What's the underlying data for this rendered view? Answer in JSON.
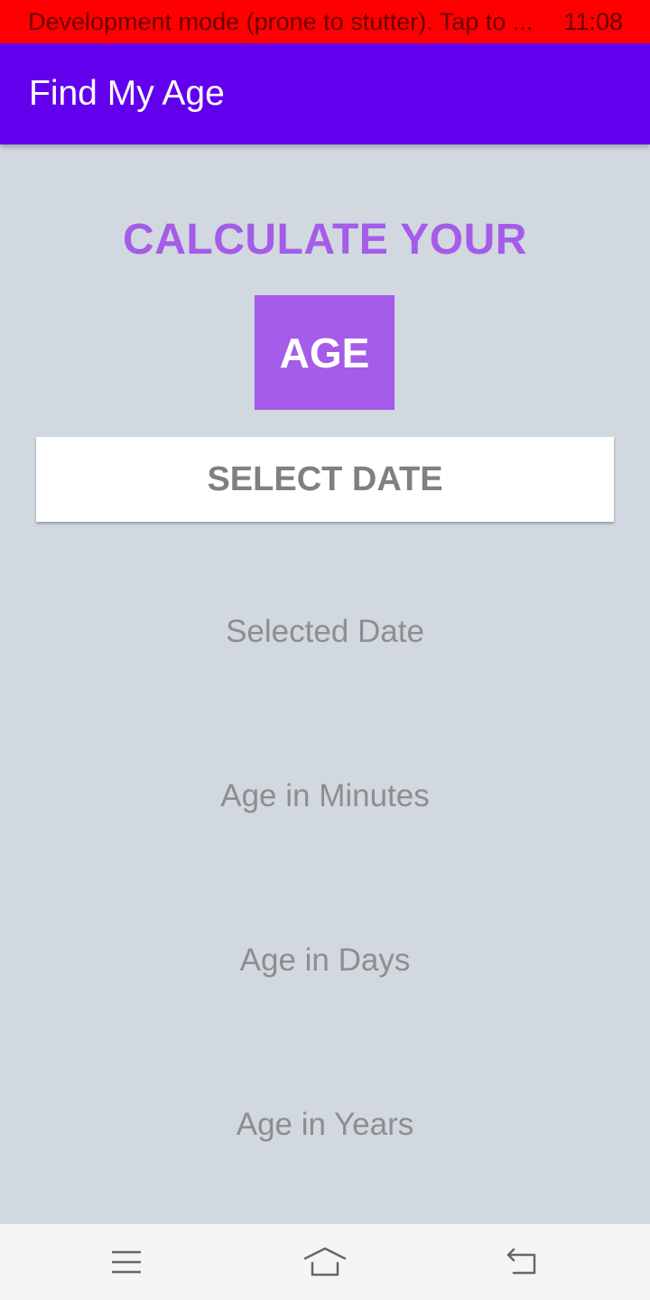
{
  "status_bar": {
    "message": "Development mode (prone to stutter). Tap to ...",
    "time": "11:08"
  },
  "app_bar": {
    "title": "Find My Age"
  },
  "main": {
    "headline": "CALCULATE YOUR",
    "age_label": "AGE",
    "select_button_label": "SELECT DATE",
    "selected_date": "Selected Date",
    "age_minutes": "Age in Minutes",
    "age_days": "Age in Days",
    "age_years": "Age in Years"
  },
  "nav_bar": {
    "icons": [
      "menu-icon",
      "home-icon",
      "back-icon"
    ]
  },
  "colors": {
    "status_bar": "#ff0000",
    "app_bar": "#6200ee",
    "accent_purple": "#a55ce8",
    "background": "#d1d8e0",
    "info_text": "#8e8e8e",
    "button_text": "#808080",
    "nav_bar": "#f5f5f5"
  }
}
